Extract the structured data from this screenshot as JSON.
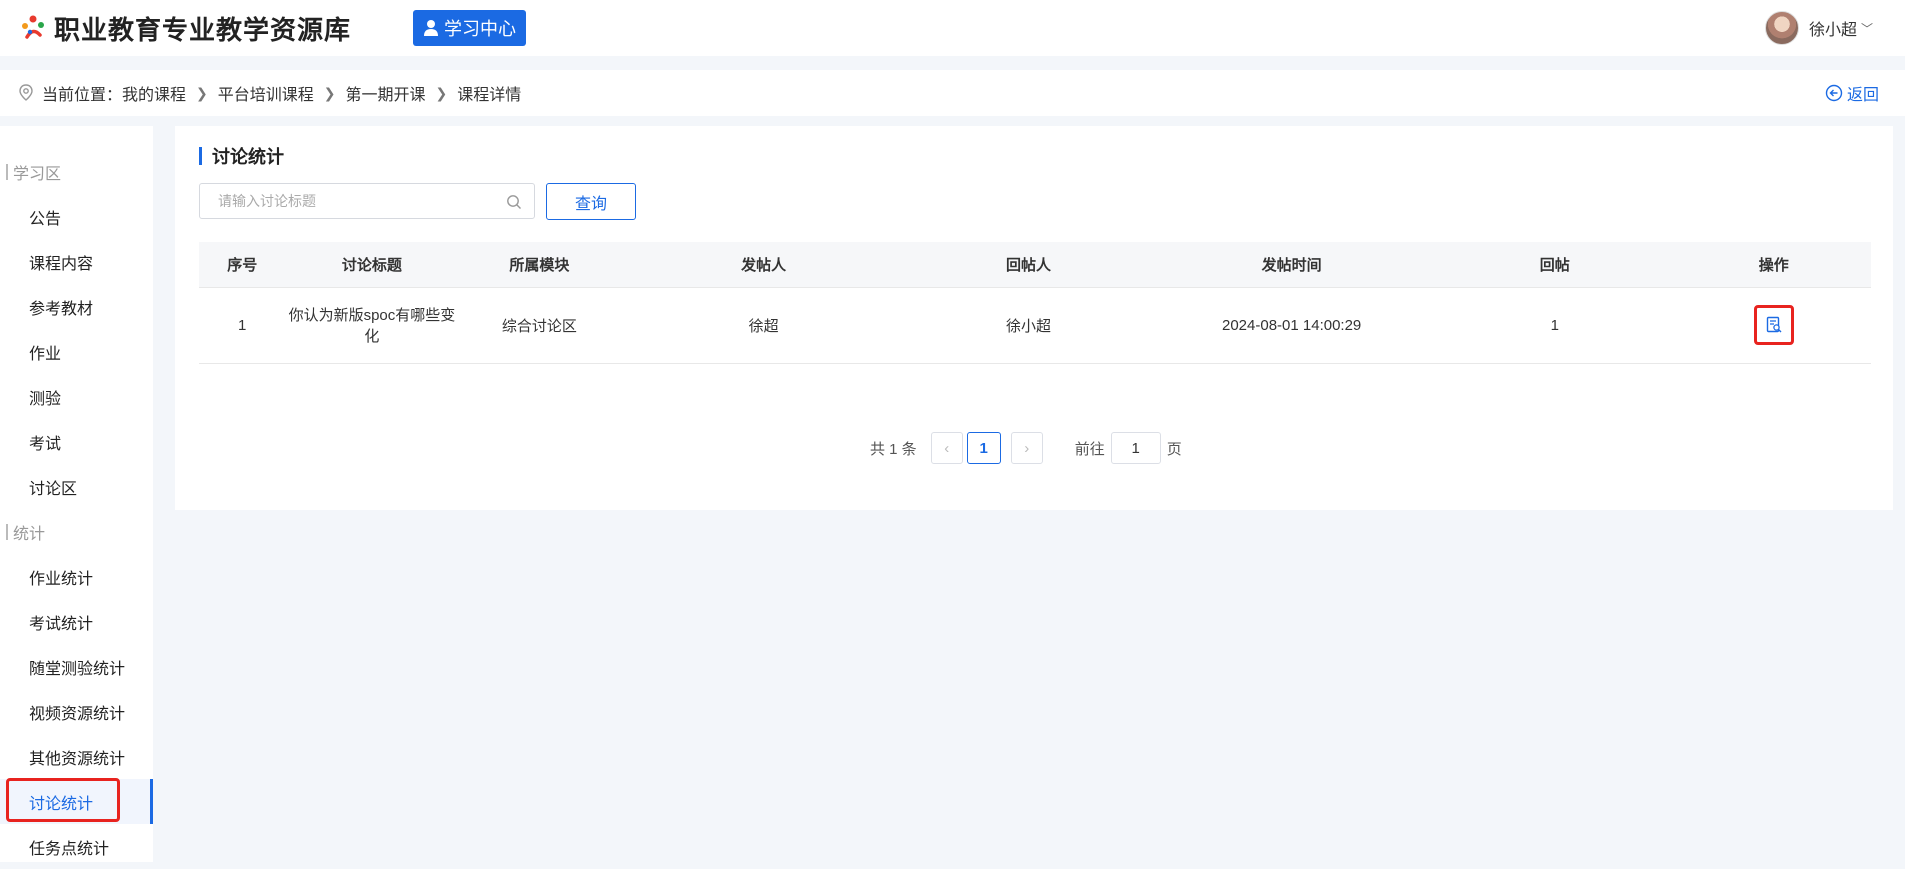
{
  "header": {
    "logo_text": "职业教育专业教学资源库",
    "learn_center": "学习中心",
    "user_name": "徐小超",
    "user_caret": "﹀"
  },
  "breadcrumb": {
    "prefix": "当前位置：",
    "items": [
      "我的课程",
      "平台培训课程",
      "第一期开课",
      "课程详情"
    ],
    "back_label": "返回"
  },
  "sidebar": {
    "group_study": "学习区",
    "study_items": [
      "公告",
      "课程内容",
      "参考教材",
      "作业",
      "测验",
      "考试",
      "讨论区"
    ],
    "group_stats": "统计",
    "stats_items": [
      "作业统计",
      "考试统计",
      "随堂测验统计",
      "视频资源统计",
      "其他资源统计",
      "讨论统计",
      "任务点统计"
    ],
    "active_item": "讨论统计"
  },
  "main": {
    "title": "讨论统计",
    "search_placeholder": "请输入讨论标题",
    "search_value": "",
    "query_label": "查询",
    "columns": [
      "序号",
      "讨论标题",
      "所属模块",
      "发帖人",
      "回帖人",
      "发帖时间",
      "回帖",
      "操作"
    ],
    "rows": [
      [
        "1",
        "你认为新版spoc有哪些变化",
        "综合讨论区",
        "徐超",
        "徐小超",
        "2024-08-01 14:00:29",
        "1"
      ]
    ]
  },
  "pagination": {
    "total_text": "共 1 条",
    "current_page": "1",
    "goto_label": "前往",
    "goto_value": "1",
    "page_suffix": "页"
  },
  "colors": {
    "accent": "#1b6ae3",
    "highlight": "#e8231f"
  }
}
